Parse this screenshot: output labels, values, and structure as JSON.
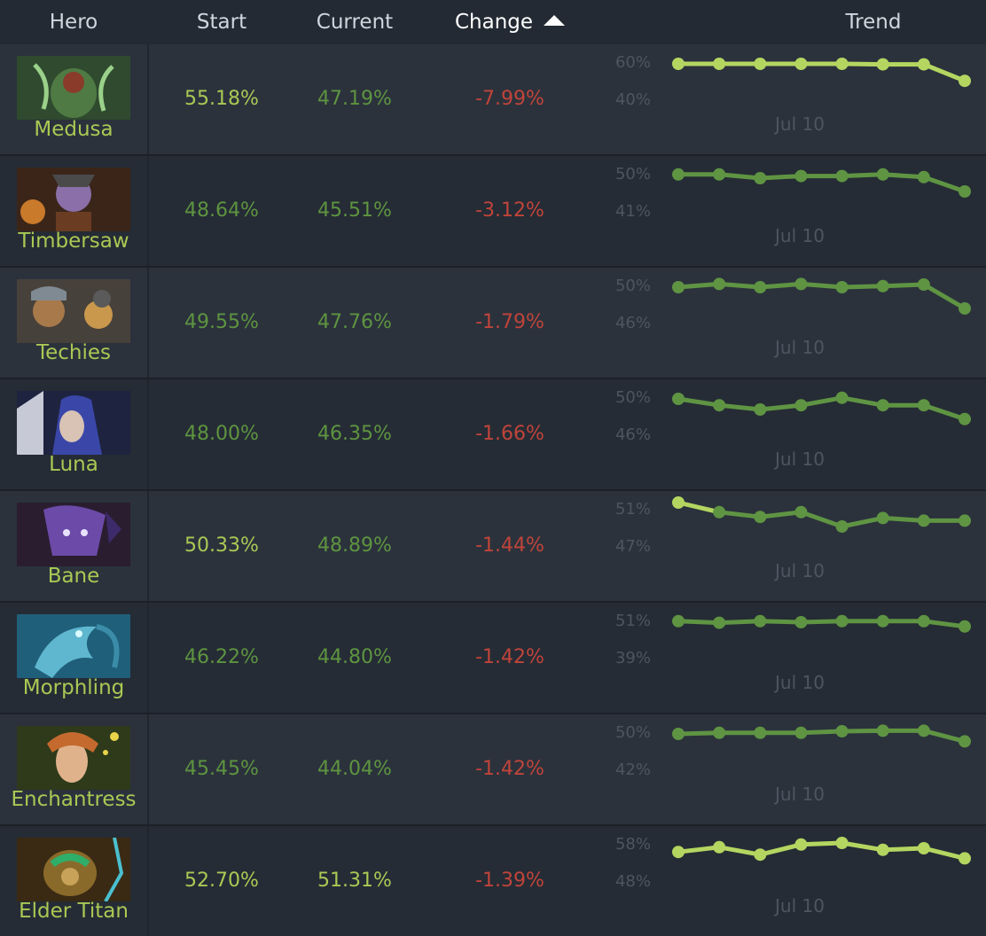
{
  "header": {
    "hero": "Hero",
    "start": "Start",
    "current": "Current",
    "change": "Change",
    "trend": "Trend"
  },
  "colors": {
    "positive_bright": "#a9c954",
    "positive_dark": "#5e9440",
    "negative": "#c0443a",
    "spark_bright": "#b4d661",
    "spark_dark": "#5f9443"
  },
  "rows": [
    {
      "hero": "Medusa",
      "start": "55.18%",
      "current": "47.19%",
      "change": "-7.99%",
      "y_top": "60%",
      "y_bottom": "40%",
      "x_label": "Jul 10",
      "tone": "bright",
      "trend": [
        0.8,
        0.8,
        0.8,
        0.8,
        0.8,
        0.79,
        0.79,
        0.48
      ]
    },
    {
      "hero": "Timbersaw",
      "start": "48.64%",
      "current": "45.51%",
      "change": "-3.12%",
      "y_top": "50%",
      "y_bottom": "41%",
      "x_label": "Jul 10",
      "tone": "dark",
      "trend": [
        0.82,
        0.82,
        0.75,
        0.79,
        0.79,
        0.82,
        0.77,
        0.5
      ]
    },
    {
      "hero": "Techies",
      "start": "49.55%",
      "current": "47.76%",
      "change": "-1.79%",
      "y_top": "50%",
      "y_bottom": "46%",
      "x_label": "Jul 10",
      "tone": "dark",
      "trend": [
        0.8,
        0.86,
        0.8,
        0.86,
        0.8,
        0.82,
        0.85,
        0.4
      ]
    },
    {
      "hero": "Luna",
      "start": "48.00%",
      "current": "46.35%",
      "change": "-1.66%",
      "y_top": "50%",
      "y_bottom": "46%",
      "x_label": "Jul 10",
      "tone": "dark",
      "trend": [
        0.8,
        0.68,
        0.6,
        0.68,
        0.82,
        0.68,
        0.68,
        0.42
      ]
    },
    {
      "hero": "Bane",
      "start": "50.33%",
      "current": "48.89%",
      "change": "-1.44%",
      "y_top": "51%",
      "y_bottom": "47%",
      "x_label": "Jul 10",
      "tone": "dark",
      "trend": [
        0.95,
        0.77,
        0.68,
        0.77,
        0.5,
        0.66,
        0.61,
        0.61
      ],
      "first_bright": true
    },
    {
      "hero": "Morphling",
      "start": "46.22%",
      "current": "44.80%",
      "change": "-1.42%",
      "y_top": "51%",
      "y_bottom": "39%",
      "x_label": "Jul 10",
      "tone": "dark",
      "trend": [
        0.82,
        0.79,
        0.82,
        0.8,
        0.82,
        0.82,
        0.82,
        0.72
      ]
    },
    {
      "hero": "Enchantress",
      "start": "45.45%",
      "current": "44.04%",
      "change": "-1.42%",
      "y_top": "50%",
      "y_bottom": "42%",
      "x_label": "Jul 10",
      "tone": "dark",
      "trend": [
        0.8,
        0.82,
        0.82,
        0.82,
        0.85,
        0.86,
        0.86,
        0.66
      ]
    },
    {
      "hero": "Elder Titan",
      "start": "52.70%",
      "current": "51.31%",
      "change": "-1.39%",
      "y_top": "58%",
      "y_bottom": "48%",
      "x_label": "Jul 10",
      "tone": "bright",
      "trend": [
        0.68,
        0.77,
        0.63,
        0.82,
        0.85,
        0.72,
        0.75,
        0.56
      ]
    }
  ],
  "value_tones": [
    {
      "start": "bright",
      "current": "dark"
    },
    {
      "start": "dark",
      "current": "dark"
    },
    {
      "start": "dark",
      "current": "dark"
    },
    {
      "start": "dark",
      "current": "dark"
    },
    {
      "start": "bright",
      "current": "dark"
    },
    {
      "start": "dark",
      "current": "dark"
    },
    {
      "start": "dark",
      "current": "dark"
    },
    {
      "start": "bright",
      "current": "bright"
    }
  ]
}
